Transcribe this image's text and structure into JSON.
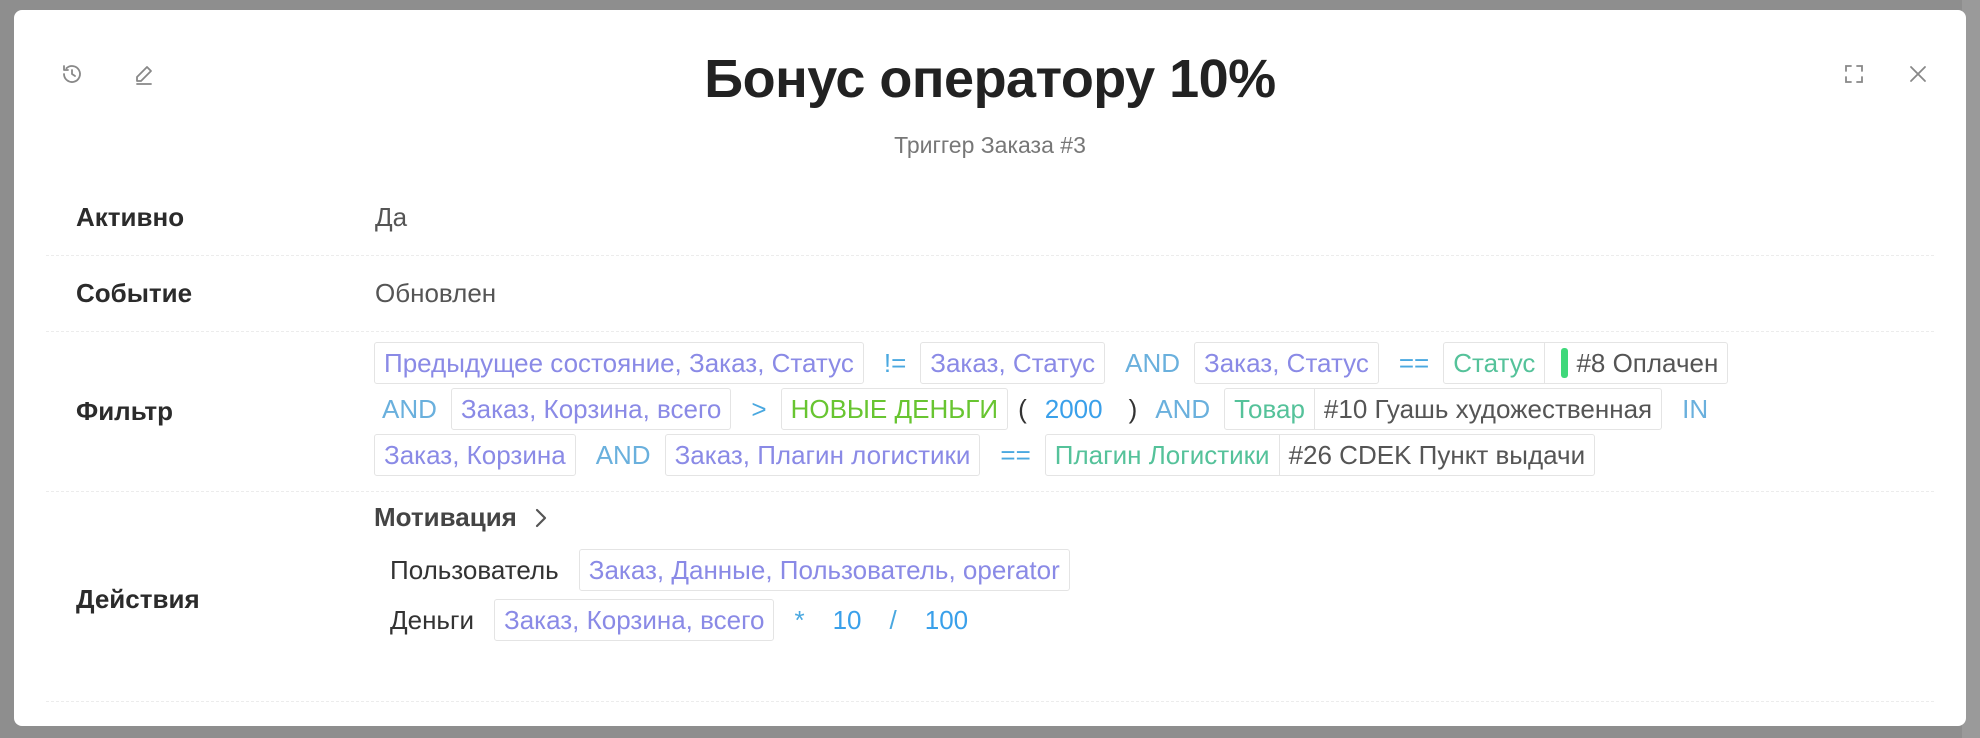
{
  "header": {
    "title": "Бонус оператору 10%",
    "subtitle": "Триггер Заказа #3"
  },
  "fields": {
    "active": {
      "label": "Активно",
      "value": "Да"
    },
    "event": {
      "label": "Событие",
      "value": "Обновлен"
    },
    "filter": {
      "label": "Фильтр"
    },
    "actions": {
      "label": "Действия"
    }
  },
  "filter": {
    "line1": {
      "c1": "Предыдущее состояние, Заказ, Статус",
      "op1": "!=",
      "c2": "Заказ, Статус",
      "and1": "AND",
      "c3": "Заказ, Статус",
      "op2": "==",
      "entity": "Статус",
      "entity_value": "#8 Оплачен"
    },
    "line2": {
      "and1": "AND",
      "c1": "Заказ, Корзина, всего",
      "op1": ">",
      "money": "НОВЫЕ ДЕНЬГИ",
      "paren_open": "(",
      "amount": "2000",
      "paren_close": ")",
      "and2": "AND",
      "entity": "Товар",
      "entity_value": "#10 Гуашь художественная",
      "in": "IN"
    },
    "line3": {
      "c1": "Заказ, Корзина",
      "and1": "AND",
      "c2": "Заказ, Плагин логистики",
      "op1": "==",
      "entity": "Плагин Логистики",
      "entity_value": "#26 CDEK Пункт выдачи"
    }
  },
  "actions": {
    "group_title": "Мотивация",
    "user": {
      "name": "Пользователь",
      "value": "Заказ, Данные, Пользователь, operator"
    },
    "money": {
      "name": "Деньги",
      "value": "Заказ, Корзина, всего",
      "op1": "*",
      "n1": "10",
      "op2": "/",
      "n2": "100"
    }
  },
  "icons": {
    "history": "history-icon",
    "edit": "edit-icon",
    "fullscreen": "fullscreen-icon",
    "close": "close-icon",
    "chevron": "chevron-right-icon"
  },
  "colors": {
    "field_chip": "#8a8ae6",
    "entity_chip": "#55c29a",
    "money_chip": "#68c531",
    "operator": "#4aa8e0",
    "status_marker": "#3fd87a"
  }
}
